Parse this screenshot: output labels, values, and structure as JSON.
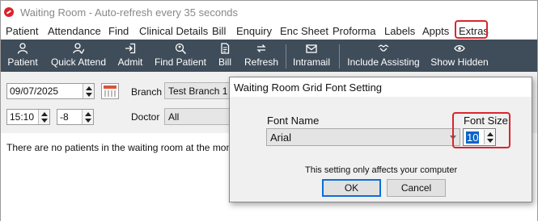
{
  "window": {
    "title": "Waiting Room - Auto-refresh every 35 seconds"
  },
  "menu": [
    {
      "label": "Patient"
    },
    {
      "label": "Attendance"
    },
    {
      "label": "Find"
    },
    {
      "label": "Clinical Details"
    },
    {
      "label": "Bill"
    },
    {
      "label": "Enquiry"
    },
    {
      "label": "Enc Sheet"
    },
    {
      "label": "Proforma"
    },
    {
      "label": "Labels"
    },
    {
      "label": "Appts"
    },
    {
      "label": "Extras"
    }
  ],
  "toolbar": [
    {
      "label": "Patient",
      "icon": "person-icon"
    },
    {
      "label": "Quick Attend",
      "icon": "person-check-icon"
    },
    {
      "label": "Admit",
      "icon": "sign-in-icon"
    },
    {
      "label": "Find Patient",
      "icon": "search-person-icon"
    },
    {
      "label": "Bill",
      "icon": "document-icon"
    },
    {
      "label": "Refresh",
      "icon": "refresh-icon"
    },
    {
      "label": "Intramail",
      "icon": "mail-icon"
    },
    {
      "label": "Include Assisting",
      "icon": "handshake-icon"
    },
    {
      "label": "Show Hidden",
      "icon": "eye-icon"
    }
  ],
  "filters": {
    "date": "09/07/2025",
    "time": "15:10",
    "offset": "-8",
    "branch_label": "Branch",
    "branch_value": "Test Branch 1",
    "doctor_label": "Doctor",
    "doctor_value": "All"
  },
  "message": "There are no patients in the waiting room at the mom",
  "dialog": {
    "title": "Waiting Room Grid Font Setting",
    "font_name_label": "Font Name",
    "font_name_value": "Arial",
    "font_size_label": "Font Size",
    "font_size_value": "10",
    "note": "This setting only affects your computer",
    "ok_label": "OK",
    "cancel_label": "Cancel"
  },
  "colors": {
    "toolbar_bg": "#3f4c59",
    "highlight": "#d8262e",
    "selection": "#0a63c9"
  }
}
